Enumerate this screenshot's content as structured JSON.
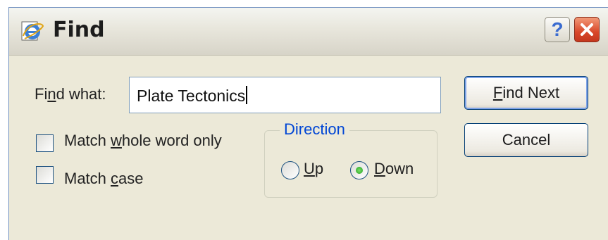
{
  "window": {
    "title": "Find"
  },
  "titlebar": {
    "help_label": "?",
    "app_icon": "internet-explorer-icon",
    "close_icon": "close-icon"
  },
  "find": {
    "label_pre": "Fi",
    "label_key": "n",
    "label_post": "d what:",
    "value": "Plate Tectonics"
  },
  "options": {
    "whole_word": {
      "pre": "Match ",
      "key": "w",
      "post": "hole word only",
      "checked": false
    },
    "match_case": {
      "pre": "Match ",
      "key": "c",
      "post": "ase",
      "checked": false
    }
  },
  "direction": {
    "title": "Direction",
    "up": {
      "key": "U",
      "post": "p",
      "selected": false
    },
    "down": {
      "key": "D",
      "post": "own",
      "selected": true
    }
  },
  "buttons": {
    "find_next": {
      "key": "F",
      "post": "ind Next"
    },
    "cancel": "Cancel"
  }
}
